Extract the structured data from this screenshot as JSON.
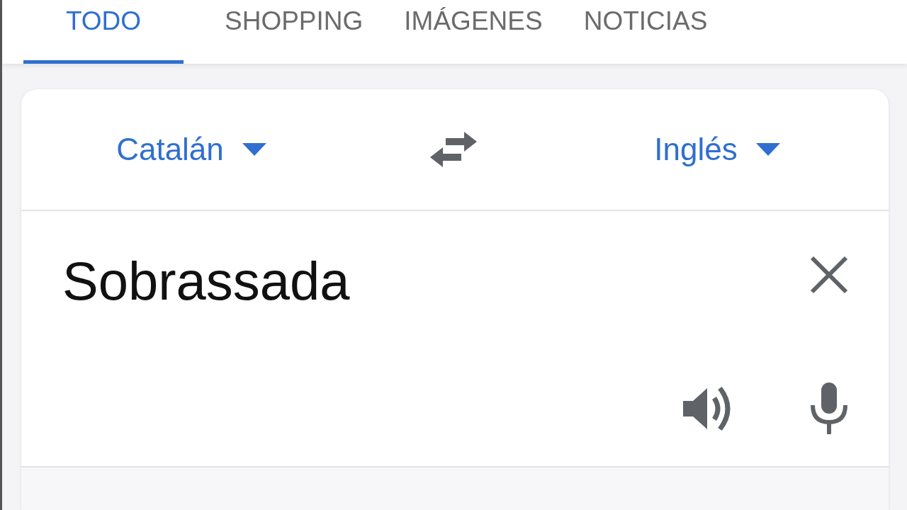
{
  "tabs": [
    {
      "label": "TODO",
      "selected": true
    },
    {
      "label": "SHOPPING",
      "selected": false
    },
    {
      "label": "IMÁGENES",
      "selected": false
    },
    {
      "label": "NOTICIAS",
      "selected": false
    }
  ],
  "translator": {
    "source_language": "Catalán",
    "target_language": "Inglés",
    "input_text": "Sobrassada"
  }
}
